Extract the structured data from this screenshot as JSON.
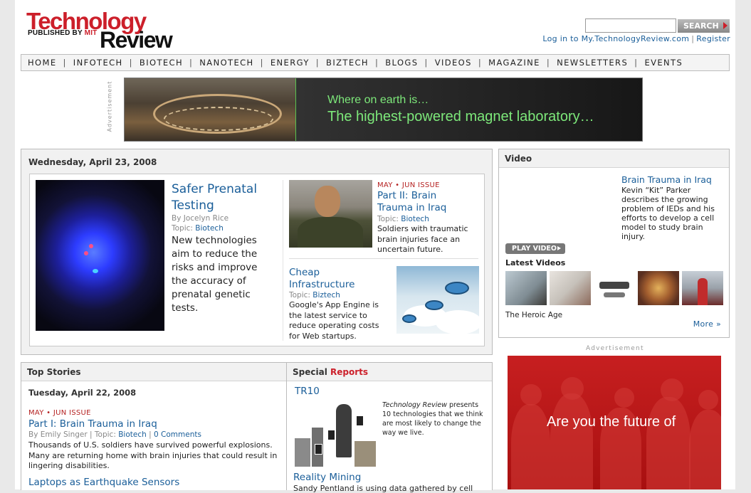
{
  "header": {
    "logo_line1": "Technology",
    "logo_published_by": "PUBLISHED BY",
    "logo_mit": "MIT",
    "logo_line2": "Review",
    "search_button": "SEARCH",
    "login_link": "Log in to My.TechnologyReview.com",
    "separator": "|",
    "register_link": "Register"
  },
  "nav": {
    "items": [
      "HOME",
      "INFOTECH",
      "BIOTECH",
      "NANOTECH",
      "ENERGY",
      "BIZTECH",
      "BLOGS",
      "VIDEOS",
      "MAGAZINE",
      "NEWSLETTERS",
      "EVENTS"
    ]
  },
  "ad_banner": {
    "label": "Advertisement",
    "line1": "Where on earth is…",
    "line2": "The highest-powered magnet laboratory…"
  },
  "featured": {
    "date": "Wednesday, April 23, 2008",
    "lead": {
      "title": "Safer Prenatal Testing",
      "byline": "By Jocelyn Rice",
      "topic_label": "Topic:",
      "topic": "Biotech",
      "summary": "New technologies aim to reduce the risks and improve the accuracy of prenatal genetic tests."
    },
    "story2": {
      "issue_may": "MAY",
      "issue_rest": "JUN ISSUE",
      "title": "Part II: Brain Trauma in Iraq",
      "topic_label": "Topic:",
      "topic": "Biotech",
      "summary": "Soldiers with traumatic brain injuries face an uncertain future."
    },
    "story3": {
      "title": "Cheap Infrastructure",
      "topic_label": "Topic:",
      "topic": "Biztech",
      "summary": "Google's App Engine is the latest service to reduce operating costs for Web startups."
    }
  },
  "video": {
    "header": "Video",
    "title": "Brain Trauma in Iraq",
    "description": "Kevin “Kit” Parker describes the growing problem of IEDs and his efforts to develop a cell model to study brain injury.",
    "play_button": "PLAY VIDEO",
    "latest_label": "Latest Videos",
    "thumb_caption": "The Heroic Age",
    "more_link": "More »"
  },
  "right_ad": {
    "label": "Advertisement",
    "text": "Are you the future of"
  },
  "top_stories": {
    "header": "Top Stories",
    "date": "Tuesday, April 22, 2008",
    "issue_may": "MAY",
    "issue_rest": "JUN ISSUE",
    "title": "Part I: Brain Trauma in Iraq",
    "byline": "By Emily Singer",
    "topic_label": "Topic:",
    "topic": "Biotech",
    "separator": "|",
    "comments": "0 Comments",
    "summary": "Thousands of U.S. soldiers have survived powerful explosions. Many are returning home with brain injuries that could result in lingering disabilities.",
    "title2": "Laptops as Earthquake Sensors"
  },
  "special_reports": {
    "header_word1": "Special",
    "header_word2": "Reports",
    "tr10_title": "TR10",
    "tr10_desc_italic": "Technology Review",
    "tr10_desc_rest": "presents 10 technologies that we think are most likely to change the way we live.",
    "reality_title": "Reality Mining",
    "reality_desc": "Sandy Pentland is using data gathered by cell"
  },
  "colors": {
    "brand_red": "#cc1f2a",
    "link_blue": "#1a5e99",
    "ad_green": "#7de87a"
  }
}
